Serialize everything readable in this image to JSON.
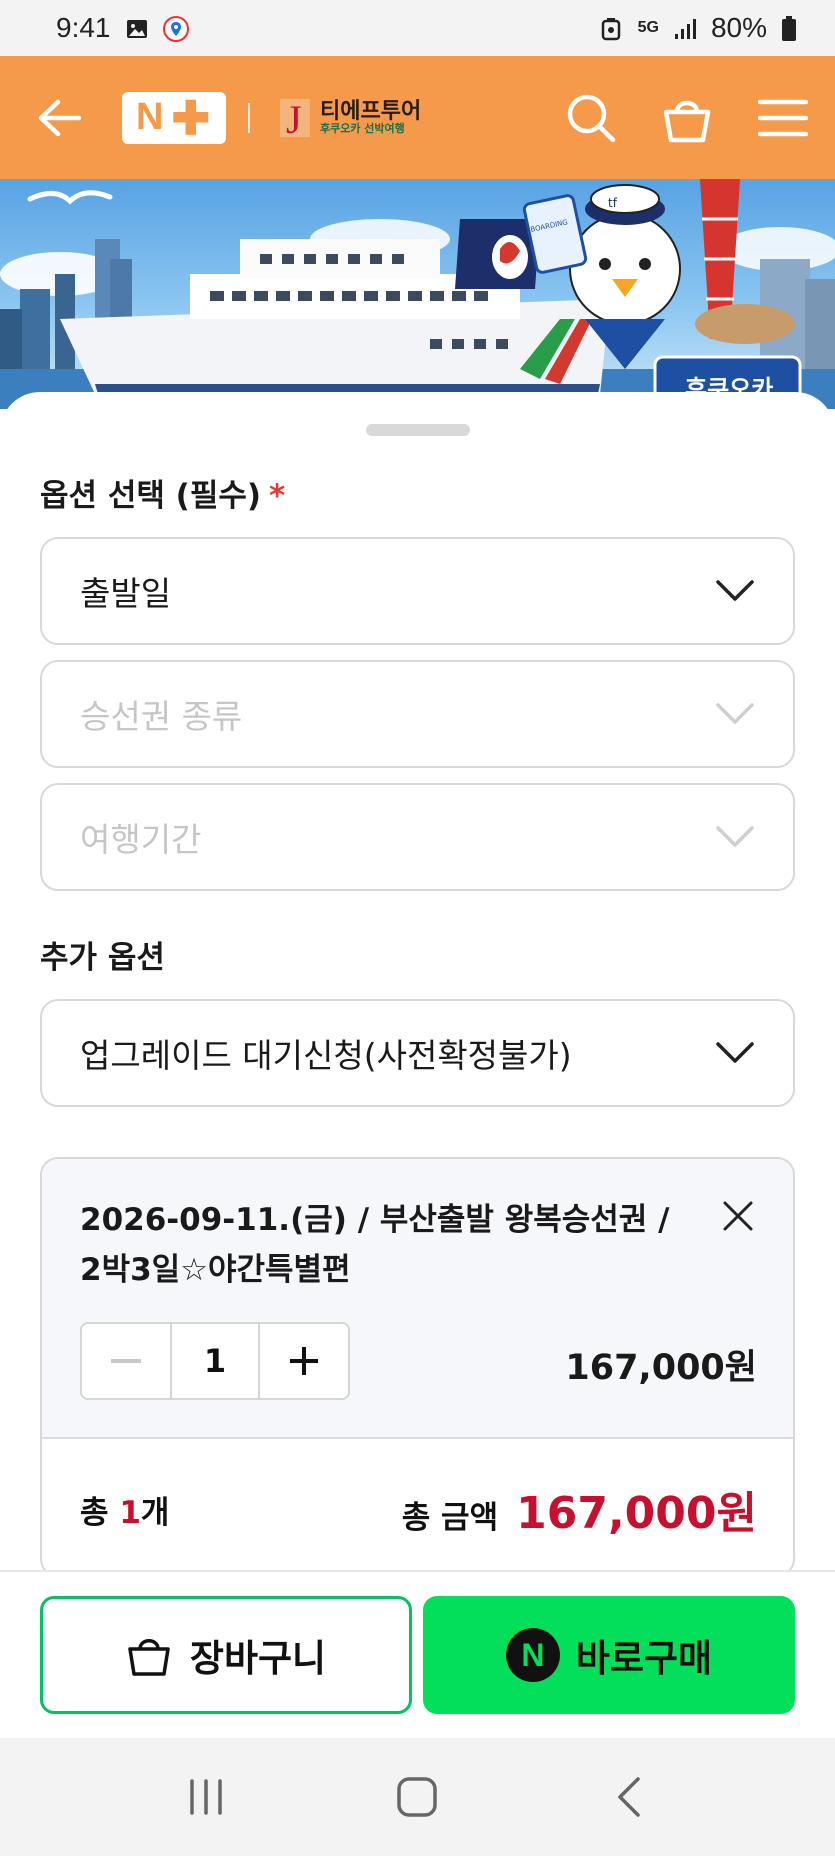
{
  "status_bar": {
    "time": "9:41",
    "network": "5G",
    "battery": "80%"
  },
  "header": {
    "nplus_logo": "N",
    "brand_name": "티에프투어",
    "brand_sub": "후쿠오카 선박여행",
    "brand_mark": "J",
    "colors": {
      "bg": "#f5994a"
    }
  },
  "banner": {
    "sign_text": "후쿠오카",
    "badge_text": "tf",
    "boarding_text": "BOARDING"
  },
  "options": {
    "required_title": "옵션 선택 (필수)",
    "required_mark": "*",
    "departure_date": "출발일",
    "ticket_type": "승선권 종류",
    "trip_period": "여행기간",
    "extra_title": "추가 옵션",
    "extra_select": "업그레이드 대기신청(사전확정불가)"
  },
  "selected_item": {
    "title": "2026-09-11.(금) / 부산출발 왕복승선권 / 2박3일☆야간특별편",
    "quantity": "1",
    "price": "167,000원"
  },
  "total": {
    "count_prefix": "총 ",
    "count": "1",
    "count_suffix": "개",
    "amount_label": "총 금액",
    "amount": "167,000",
    "amount_unit": "원",
    "accent_color": "#c8102e"
  },
  "actions": {
    "cart_label": "장바구니",
    "buy_label": "바로구매",
    "buy_color": "#03de5b"
  }
}
